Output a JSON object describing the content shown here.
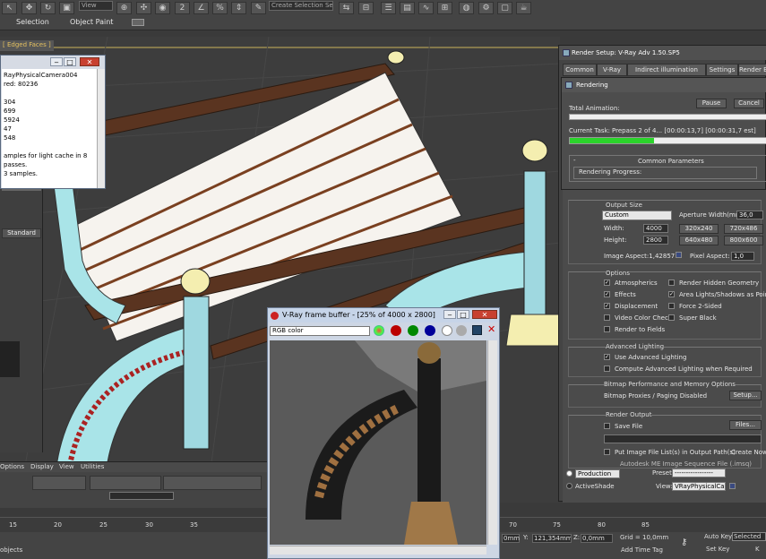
{
  "toolbar": {
    "view_select": "View",
    "selection_set": "Create Selection Se",
    "selection_label": "Selection",
    "object_paint_label": "Object Paint"
  },
  "viewport": {
    "header": "[ Edged Faces ]"
  },
  "log": {
    "lines": [
      "RayPhysicalCamera004",
      "",
      "red: 80236",
      "",
      "304",
      "699",
      "5924",
      "47",
      "548",
      "",
      "amples for light cache in 8 passes.",
      "3 samples."
    ]
  },
  "left_panel": {
    "standard": "Standard"
  },
  "menu": {
    "items": [
      "Options",
      "Display",
      "View",
      "Utilities"
    ]
  },
  "timeline": {
    "ticks": [
      "15",
      "20",
      "25",
      "30",
      "35",
      "70",
      "75",
      "80",
      "85"
    ],
    "status": "objects"
  },
  "statusbar": {
    "y_label": "Y:",
    "y_value": "121,354mm",
    "z_label": "Z:",
    "z_value": "0,0mm",
    "grid": "Grid = 10,0mm",
    "add_time_tag": "Add Time Tag",
    "auto_key": "Auto Key",
    "auto_key_select": "Selected",
    "set_key": "Set Key",
    "key_filters": "K",
    "frame_left": "0mm"
  },
  "render_setup": {
    "title": "Render Setup: V-Ray Adv 1.50.SP5",
    "tabs": [
      "Common",
      "V-Ray",
      "Indirect illumination",
      "Settings",
      "Render E"
    ],
    "output_size": {
      "header": "Output Size",
      "preset": "Custom",
      "aperture_label": "Aperture Width(mm):",
      "aperture_value": "36,0",
      "width_label": "Width:",
      "width_value": "4000",
      "height_label": "Height:",
      "height_value": "2800",
      "presets": [
        "320x240",
        "720x486",
        "640x480",
        "800x600"
      ],
      "image_aspect": "Image Aspect:1,42857",
      "pixel_aspect_label": "Pixel Aspect:",
      "pixel_aspect_value": "1,0"
    },
    "options": {
      "header": "Options",
      "items": [
        {
          "label": "Atmospherics",
          "checked": true
        },
        {
          "label": "Render Hidden Geometry",
          "checked": false
        },
        {
          "label": "Effects",
          "checked": true
        },
        {
          "label": "Area Lights/Shadows as Points",
          "checked": true
        },
        {
          "label": "Displacement",
          "checked": true
        },
        {
          "label": "Force 2-Sided",
          "checked": false
        },
        {
          "label": "Video Color Check",
          "checked": false
        },
        {
          "label": "Super Black",
          "checked": false
        },
        {
          "label": "Render to Fields",
          "checked": false
        }
      ]
    },
    "advanced_lighting": {
      "header": "Advanced Lighting",
      "use": "Use Advanced Lighting",
      "use_checked": true,
      "compute": "Compute Advanced Lighting when Required",
      "compute_checked": false
    },
    "bitmap": {
      "header": "Bitmap Performance and Memory Options",
      "proxies": "Bitmap Proxies / Paging Disabled",
      "setup_button": "Setup..."
    },
    "render_output": {
      "header": "Render Output",
      "save_file": "Save File",
      "files_button": "Files...",
      "put_image": "Put Image File List(s) in Output Path(s)",
      "create_now": "Create Now",
      "autodesk": "Autodesk ME Image Sequence File (.imsq)"
    },
    "bottom": {
      "production": "Production",
      "activeshade": "ActiveShade",
      "preset_label": "Preset:",
      "preset_value": "-----------------",
      "view_label": "View:",
      "view_value": "VRayPhysicalCa"
    }
  },
  "rendering": {
    "title": "Rendering",
    "pause": "Pause",
    "cancel": "Cancel",
    "total_label": "Total Animation:",
    "total_progress": 0.0,
    "task_label": "Current Task:",
    "task_text": "Prepass 2 of 4... [00:00:13,7] [00:00:31,7 est]",
    "task_progress": 0.43,
    "common_params": "Common Parameters",
    "rendering_progress": "Rendering Progress:"
  },
  "frame_buffer": {
    "title": "V-Ray frame buffer - [25% of 4000 x 2800]",
    "channel": "RGB color"
  },
  "colors": {
    "accent": "#e4c060",
    "progress": "#2bd42b"
  }
}
